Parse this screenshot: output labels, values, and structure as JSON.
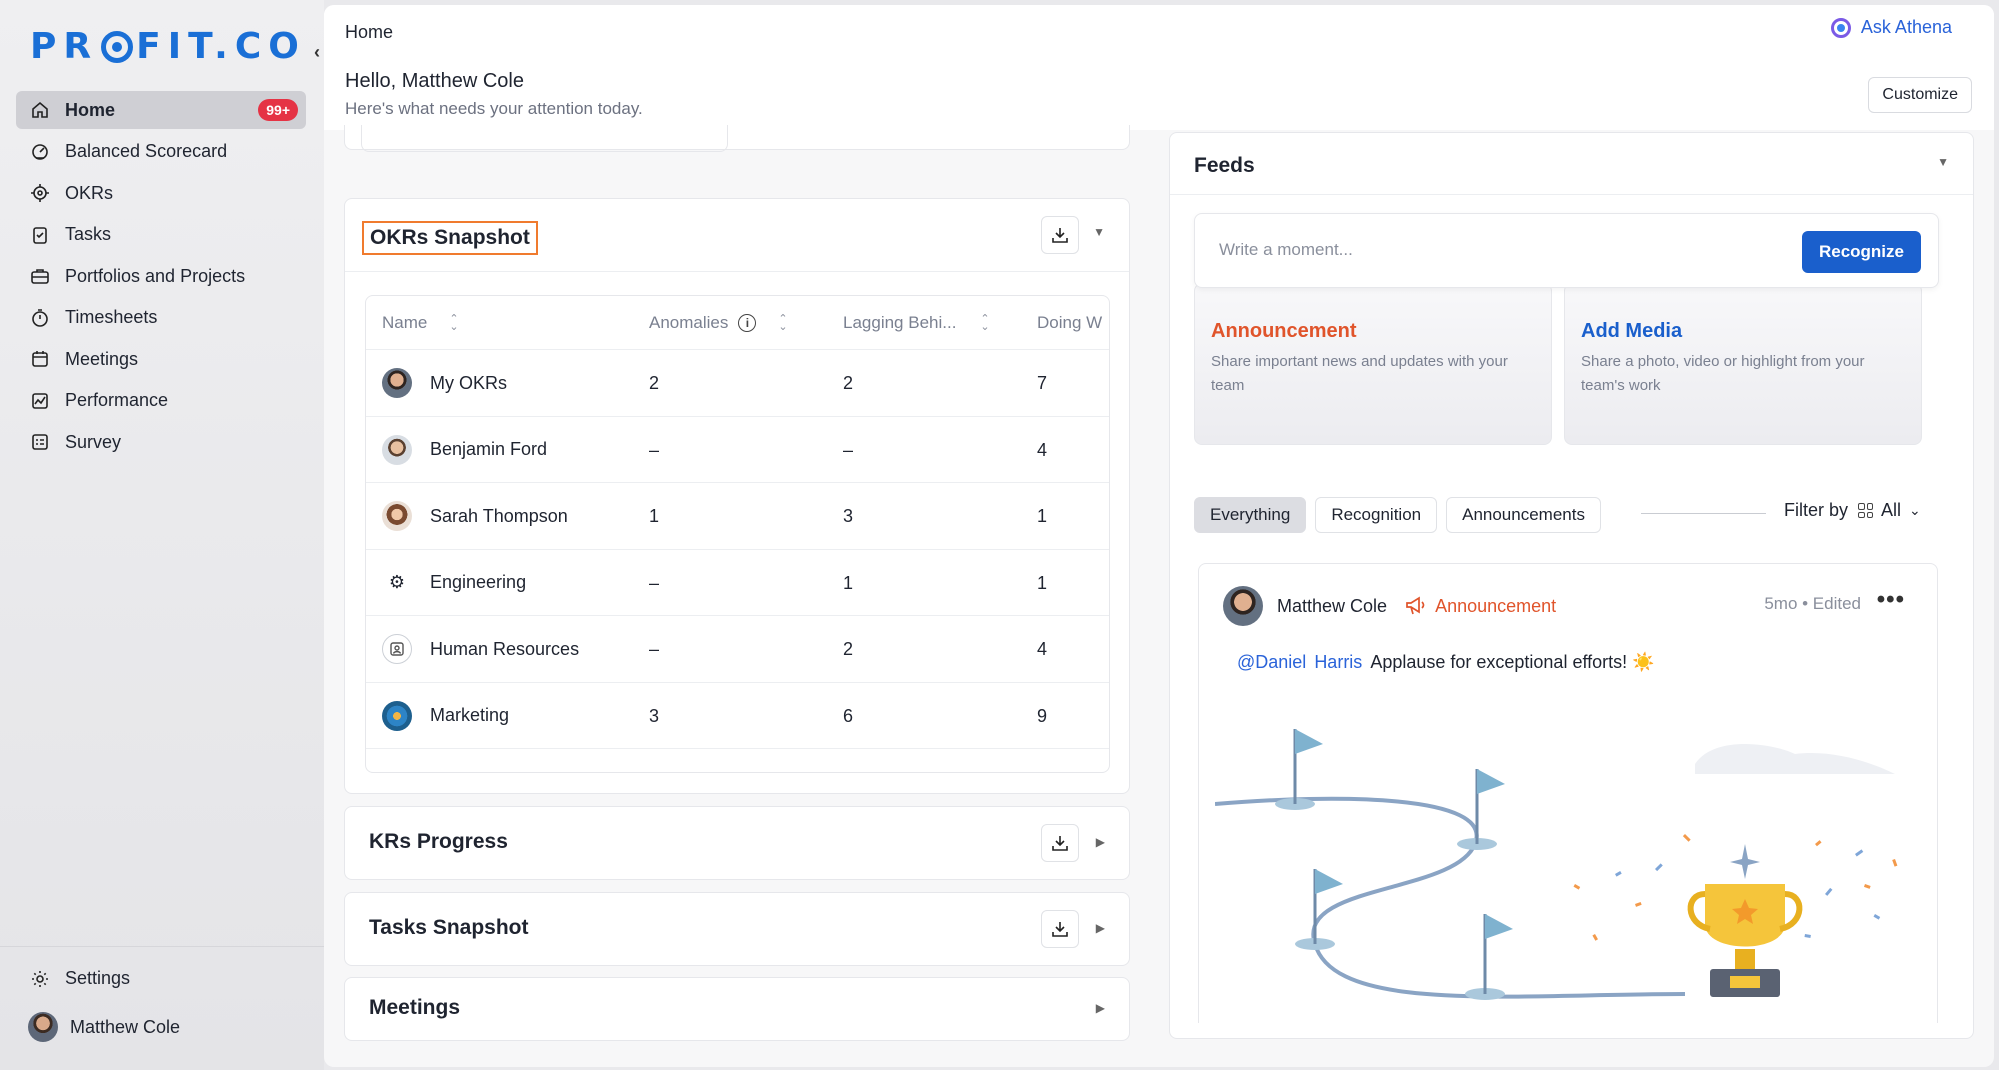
{
  "brand": {
    "logo_pre": "PR",
    "logo_post": "FIT.CO",
    "color": "#1a6fd6"
  },
  "sidebar": {
    "items": [
      {
        "label": "Home",
        "icon": "home-icon",
        "active": true,
        "badge": "99+"
      },
      {
        "label": "Balanced Scorecard",
        "icon": "scorecard-icon"
      },
      {
        "label": "OKRs",
        "icon": "target-icon"
      },
      {
        "label": "Tasks",
        "icon": "clipboard-icon"
      },
      {
        "label": "Portfolios and Projects",
        "icon": "briefcase-icon"
      },
      {
        "label": "Timesheets",
        "icon": "stopwatch-icon"
      },
      {
        "label": "Meetings",
        "icon": "calendar-icon"
      },
      {
        "label": "Performance",
        "icon": "chart-icon"
      },
      {
        "label": "Survey",
        "icon": "survey-icon"
      }
    ],
    "settings_label": "Settings",
    "user_name": "Matthew Cole"
  },
  "header": {
    "breadcrumb": "Home",
    "ask_label": "Ask Athena",
    "greeting": "Hello, Matthew Cole",
    "subtitle": "Here's what needs your attention today.",
    "customize_label": "Customize"
  },
  "okr_snapshot": {
    "title": "OKRs Snapshot",
    "columns": [
      "Name",
      "Anomalies",
      "Lagging Behi...",
      "Doing W"
    ],
    "rows": [
      {
        "name": "My OKRs",
        "anomalies": "2",
        "lagging": "2",
        "doing": "7",
        "avatar": "person1"
      },
      {
        "name": "Benjamin Ford",
        "anomalies": "–",
        "lagging": "–",
        "doing": "4",
        "avatar": "person2"
      },
      {
        "name": "Sarah Thompson",
        "anomalies": "1",
        "lagging": "3",
        "doing": "1",
        "avatar": "person3"
      },
      {
        "name": "Engineering",
        "anomalies": "–",
        "lagging": "1",
        "doing": "1",
        "avatar": "eng"
      },
      {
        "name": "Human Resources",
        "anomalies": "–",
        "lagging": "2",
        "doing": "4",
        "avatar": "hr"
      },
      {
        "name": "Marketing",
        "anomalies": "3",
        "lagging": "6",
        "doing": "9",
        "avatar": "mkt"
      }
    ]
  },
  "widgets": {
    "krs_title": "KRs Progress",
    "tasks_title": "Tasks Snapshot",
    "meetings_title": "Meetings"
  },
  "feeds": {
    "title": "Feeds",
    "write_placeholder": "Write a moment...",
    "recognize_label": "Recognize",
    "announcement": {
      "title": "Announcement",
      "desc": "Share important news and updates with your team"
    },
    "media": {
      "title": "Add Media",
      "desc": "Share a photo, video or highlight from your team's work"
    },
    "tabs": [
      "Everything",
      "Recognition",
      "Announcements"
    ],
    "filter_label": "Filter by",
    "filter_value": "All",
    "post": {
      "author": "Matthew Cole",
      "tag": "Announcement",
      "meta": "5mo • Edited",
      "mention_1": "@Daniel",
      "mention_2": "Harris",
      "text": "Applause for exceptional efforts! ☀️"
    }
  },
  "colors": {
    "accent": "#1a5fcc",
    "badge": "#e53345",
    "highlight": "#f07b2e",
    "announcement": "#e0542b"
  }
}
